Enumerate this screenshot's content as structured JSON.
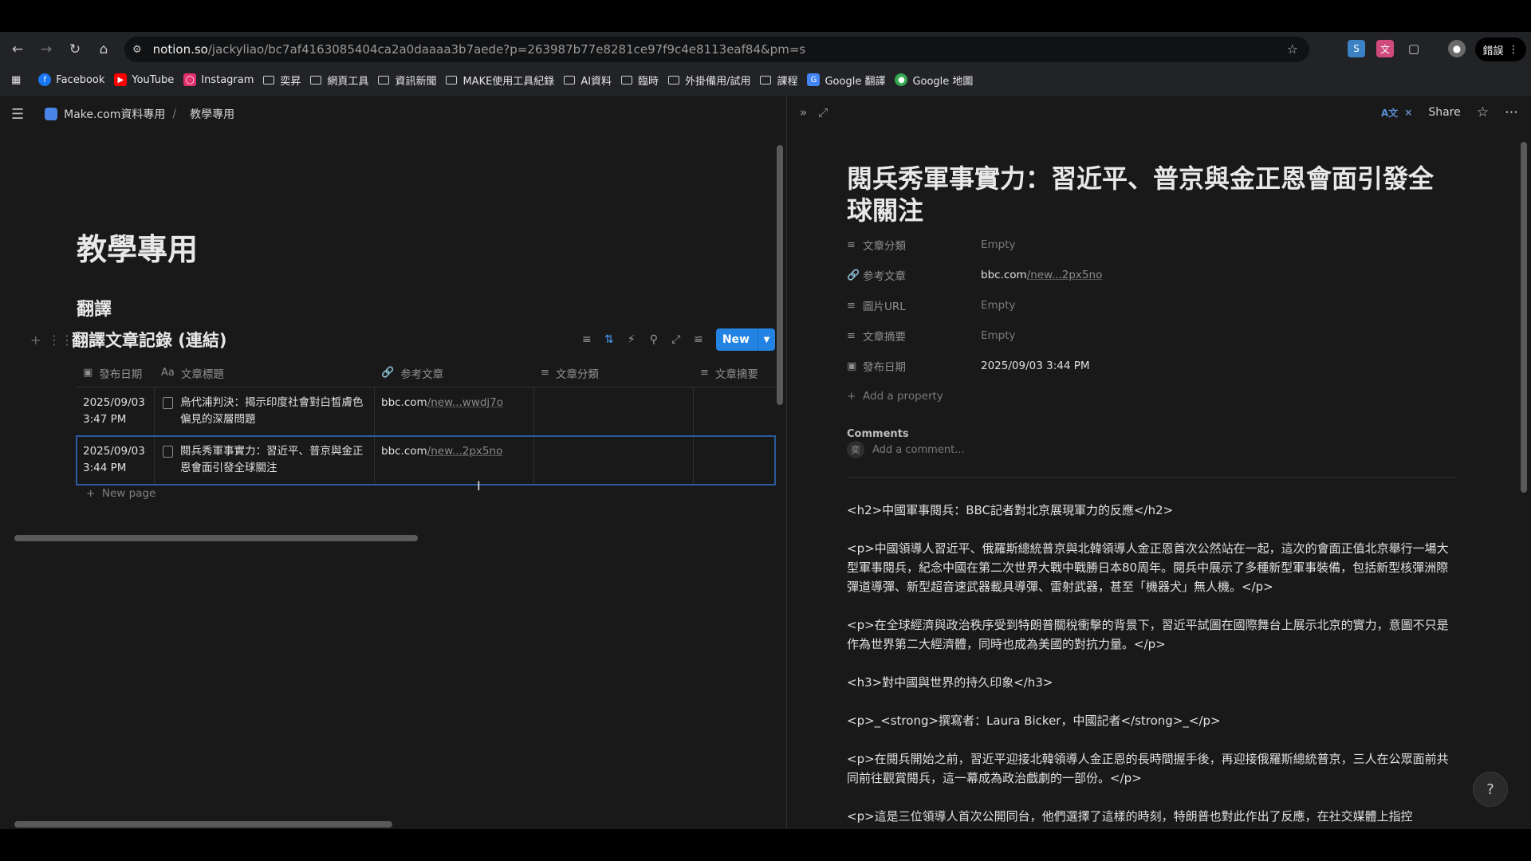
{
  "browser": {
    "url_host": "notion.so",
    "url_path": "/jackyliao/bc7af4163085404ca2a0daaaa3b7aede?p=263987b77e8281ce97f9c4e8113eaf84&pm=s",
    "profile_label": "錯誤",
    "bookmarks": [
      {
        "label": "Facebook",
        "icon": "facebook-icon",
        "color": "#1877f2"
      },
      {
        "label": "YouTube",
        "icon": "youtube-icon",
        "color": "#ff0000"
      },
      {
        "label": "Instagram",
        "icon": "instagram-icon",
        "color": "#e1306c"
      },
      {
        "label": "奕昇",
        "icon": "folder-icon"
      },
      {
        "label": "網頁工具",
        "icon": "folder-icon"
      },
      {
        "label": "資訊新聞",
        "icon": "folder-icon"
      },
      {
        "label": "MAKE使用工具紀錄",
        "icon": "folder-icon"
      },
      {
        "label": "AI資料",
        "icon": "folder-icon"
      },
      {
        "label": "臨時",
        "icon": "folder-icon"
      },
      {
        "label": "外掛備用/試用",
        "icon": "folder-icon"
      },
      {
        "label": "課程",
        "icon": "folder-icon"
      },
      {
        "label": "Google 翻譯",
        "icon": "google-translate-icon",
        "color": "#4285f4"
      },
      {
        "label": "Google 地圖",
        "icon": "google-maps-icon",
        "color": "#34a853"
      }
    ]
  },
  "left": {
    "breadcrumb": [
      "Make.com資料專用",
      "教學專用"
    ],
    "page_title": "教學專用",
    "section_heading": "翻譯",
    "db_title": "翻譯文章記錄 (連結)",
    "new_button": "New",
    "columns": [
      "發布日期",
      "文章標題",
      "参考文章",
      "文章分類",
      "文章摘要"
    ],
    "rows": [
      {
        "date": "2025/09/03",
        "time": "3:47 PM",
        "title": "烏代浦判決：揭示印度社會對白皙膚色偏見的深層問題",
        "link_host": "bbc.com",
        "link_path": "/new...wwdj7o",
        "category": "",
        "summary": ""
      },
      {
        "date": "2025/09/03",
        "time": "3:44 PM",
        "title": "閱兵秀軍事實力：習近平、普京與金正恩會面引發全球關注",
        "link_host": "bbc.com",
        "link_path": "/new...2px5no",
        "category": "",
        "summary": ""
      }
    ],
    "new_page": "New page"
  },
  "right": {
    "share": "Share",
    "translate_badge": "A文",
    "title": "閱兵秀軍事實力：習近平、普京與金正恩會面引發全球關注",
    "props": [
      {
        "key": "文章分類",
        "value": "Empty",
        "icon": "list-icon",
        "empty": true
      },
      {
        "key": "参考文章",
        "value_host": "bbc.com",
        "value_path": "/new...2px5no",
        "icon": "link-icon"
      },
      {
        "key": "圖片URL",
        "value": "Empty",
        "icon": "text-icon",
        "empty": true
      },
      {
        "key": "文章摘要",
        "value": "Empty",
        "icon": "text-icon",
        "empty": true
      },
      {
        "key": "發布日期",
        "value": "2025/09/03 3:44 PM",
        "icon": "calendar-icon"
      }
    ],
    "add_property": "Add a property",
    "comments_heading": "Comments",
    "comment_placeholder": "Add a comment...",
    "avatar_letter": "奕",
    "body": [
      "<h2>中國軍事閱兵：BBC記者對北京展現軍力的反應</h2>",
      "<p>中國領導人習近平、俄羅斯總統普京與北韓領導人金正恩首次公然站在一起，這次的會面正值北京舉行一場大型軍事閱兵，紀念中國在第二次世界大戰中戰勝日本80周年。閱兵中展示了多種新型軍事裝備，包括新型核彈洲際彈道導彈、新型超音速武器載具導彈、雷射武器，甚至「機器犬」無人機。</p>",
      "<p>在全球經濟與政治秩序受到特朗普關稅衝擊的背景下，習近平試圖在國際舞台上展示北京的實力，意圖不只是作為世界第二大經濟體，同時也成為美國的對抗力量。</p>",
      "<h3>對中國與世界的持久印象</h3>",
      "<p>_<strong>撰寫者：Laura Bicker，中國記者</strong>_</p>",
      "<p>在閱兵開始之前，習近平迎接北韓領導人金正恩的長時間握手後，再迎接俄羅斯總統普京，三人在公眾面前共同前往觀賞閱兵，這一幕成為政治戲劇的一部份。</p>",
      "<p>這是三位領導人首次公開同台，他們選擇了這樣的時刻，特朗普也對此作出了反應，在社交媒體上指控"
    ]
  }
}
